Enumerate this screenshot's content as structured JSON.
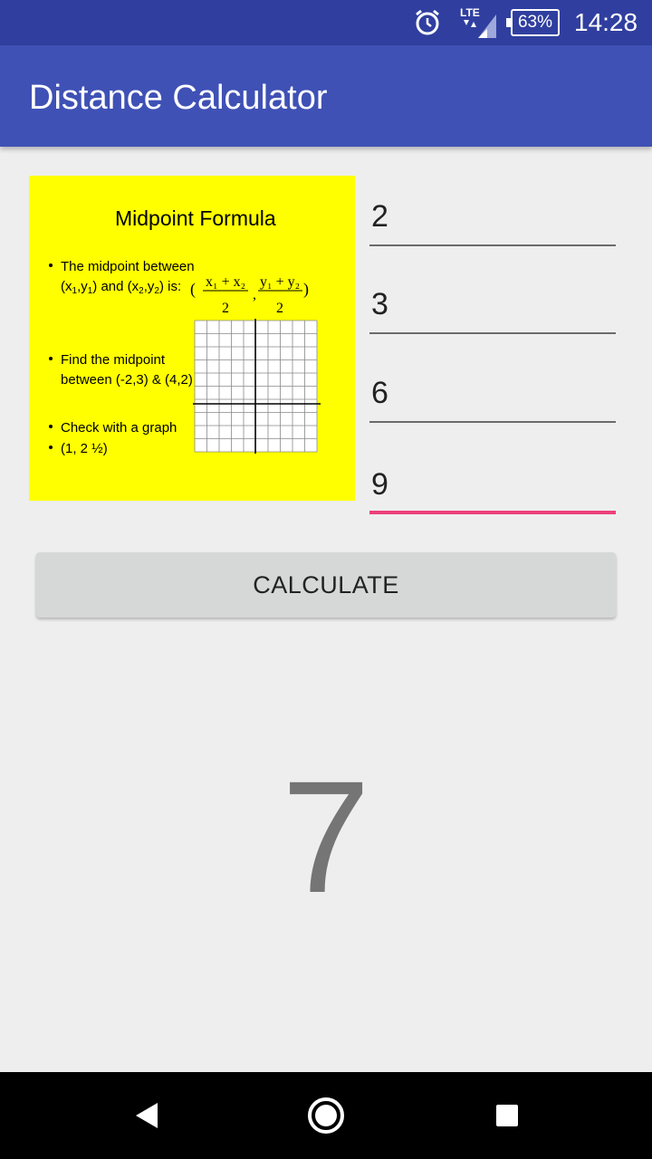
{
  "status_bar": {
    "network": "LTE",
    "battery": "63%",
    "time": "14:28",
    "icons": [
      "alarm-icon",
      "signal-icon",
      "battery-icon"
    ]
  },
  "app_bar": {
    "title": "Distance Calculator"
  },
  "thumbnail": {
    "title": "Midpoint Formula",
    "bullet1_line1": "The midpoint between",
    "bullet1_line2_a": "(x",
    "bullet1_line2_b": ",y",
    "bullet1_line2_c": ") and (x",
    "bullet1_line2_d": ",y",
    "bullet1_line2_e": ") is:",
    "bullet2_line1": "Find the midpoint",
    "bullet2_line2": "between (-2,3) & (4,2)",
    "bullet3": "Check with a graph",
    "bullet4": "(1, 2 ½)",
    "formula_num1": "x₁ + x₂",
    "formula_num2": "y₁ + y₂",
    "formula_den": "2",
    "background": "#ffff00"
  },
  "inputs": {
    "x1": "2",
    "y1": "3",
    "x2": "6",
    "y2": "9"
  },
  "calculate_button": {
    "label": "CALCULATE"
  },
  "result": {
    "value": "7"
  },
  "colors": {
    "status_bar": "#303f9f",
    "app_bar": "#3f51b5",
    "accent": "#ec407a",
    "result_text": "#757575"
  }
}
